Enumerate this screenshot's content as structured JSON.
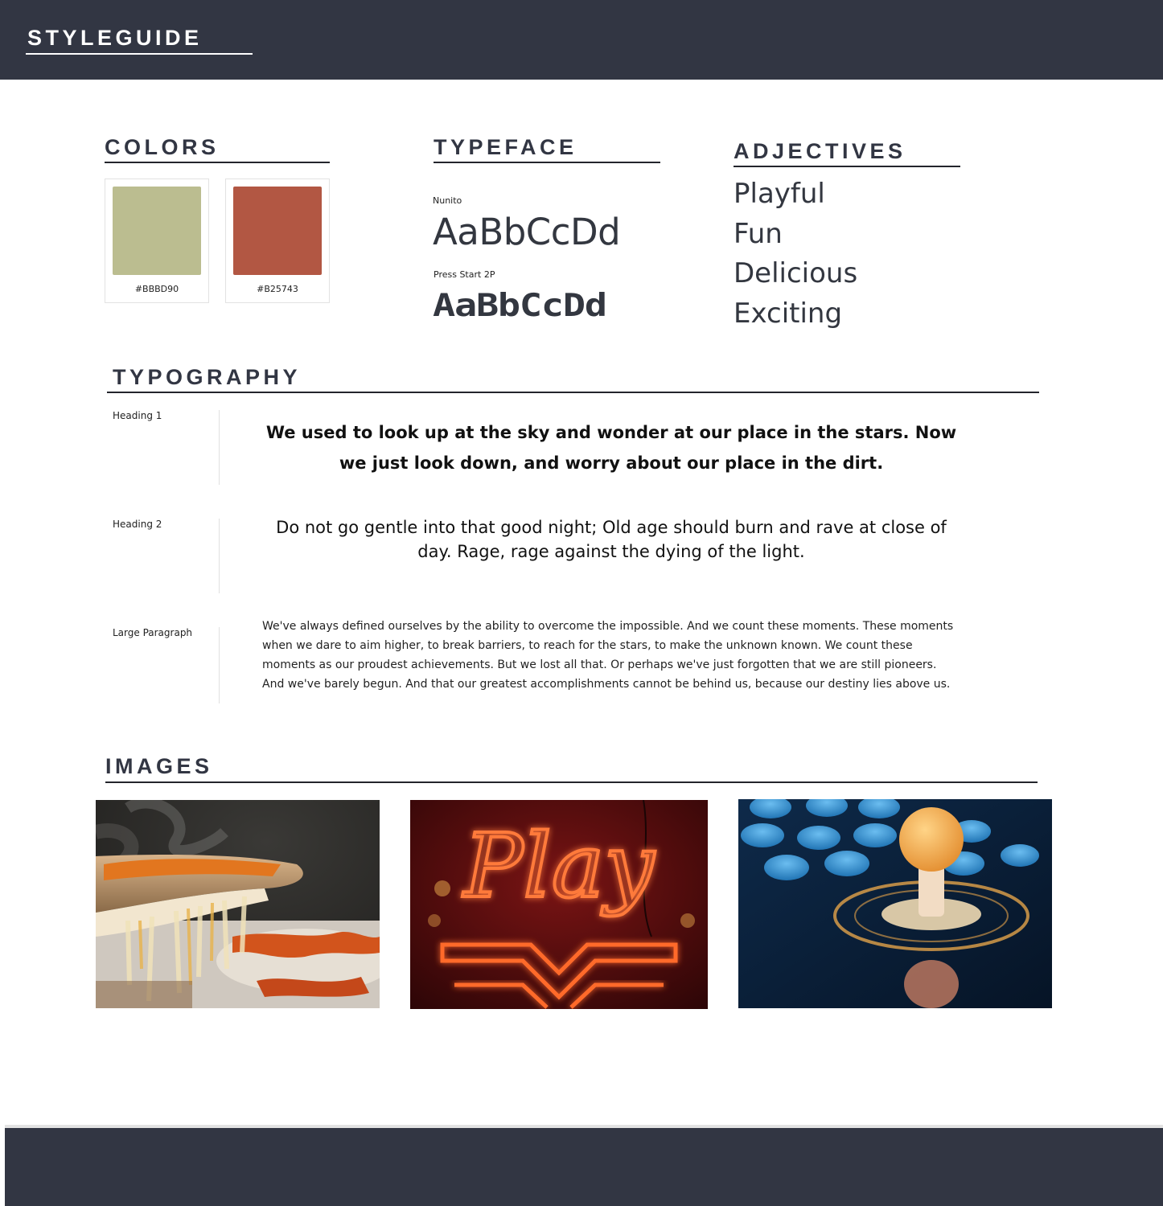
{
  "header": {
    "brand": "STYLEGUIDE"
  },
  "colors": {
    "title": "COLORS",
    "swatches": [
      {
        "hex": "#BBBD90",
        "label": "#BBBD90"
      },
      {
        "hex": "#B25743",
        "label": "#B25743"
      }
    ]
  },
  "typeface": {
    "title": "TYPEFACE",
    "fonts": [
      {
        "name": "Nunito",
        "sample": "AaBbCcDd"
      },
      {
        "name": "Press Start 2P",
        "sample": "AaBbCcDd"
      }
    ]
  },
  "adjectives": {
    "title": "ADJECTIVES",
    "items": [
      "Playful",
      "Fun",
      "Delicious",
      "Exciting"
    ]
  },
  "typography": {
    "title": "TYPOGRAPHY",
    "rows": [
      {
        "label": "Heading 1",
        "sample": "We used to look up at the sky and wonder at our place in the stars. Now we just look down, and worry about our place in the dirt."
      },
      {
        "label": "Heading 2",
        "sample": "Do not go gentle into that good night; Old age should burn and rave at close of day.  Rage, rage against the dying of the light."
      },
      {
        "label": "Large Paragraph",
        "sample": "We've always defined ourselves by the ability to overcome the impossible. And we count these moments. These moments when we dare to aim higher, to break barriers, to reach for the stars, to make the unknown known. We count these moments as our proudest achievements. But we lost all that. Or perhaps we've just forgotten that we are still pioneers. And we've barely begun. And that our greatest accomplishments cannot be behind us, because our destiny lies above us."
      }
    ]
  },
  "images": {
    "title": "IMAGES",
    "items": [
      {
        "subject": "pizza-photo"
      },
      {
        "subject": "neon-play-sign-photo",
        "text": "Play"
      },
      {
        "subject": "arcade-joystick-photo"
      }
    ]
  }
}
